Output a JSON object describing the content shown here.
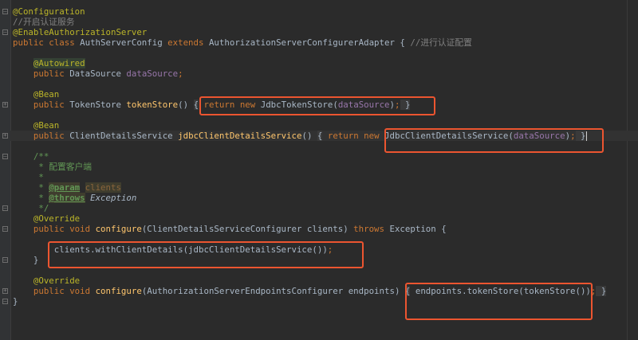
{
  "editor": {
    "current_line": 12,
    "lines": [
      [
        [
          "@Configuration",
          "ann"
        ]
      ],
      [
        [
          "//开启认证服务",
          "cm"
        ]
      ],
      [
        [
          "@EnableAuthorizationServer",
          "ann"
        ]
      ],
      [
        [
          "public class ",
          "kw"
        ],
        [
          "AuthServerConfig ",
          ""
        ],
        [
          "extends ",
          "kw"
        ],
        [
          "AuthorizationServerConfigurerAdapter { ",
          ""
        ],
        [
          "//进行认证配置",
          "cm"
        ]
      ],
      [],
      [
        [
          "    ",
          ""
        ],
        [
          "@Autowired",
          "ann ann-hl"
        ]
      ],
      [
        [
          "    public ",
          "kw"
        ],
        [
          "DataSource ",
          ""
        ],
        [
          "dataSource",
          "fld"
        ],
        [
          ";",
          "kw"
        ]
      ],
      [],
      [
        [
          "    ",
          ""
        ],
        [
          "@Bean",
          "ann"
        ]
      ],
      [
        [
          "    public ",
          "kw"
        ],
        [
          "TokenStore ",
          ""
        ],
        [
          "tokenStore",
          "fn"
        ],
        [
          "() ",
          ""
        ],
        [
          "{",
          "fold-b"
        ],
        [
          " return new ",
          "kw"
        ],
        [
          "JdbcTokenStore(",
          ""
        ],
        [
          "dataSource",
          "fld"
        ],
        [
          ")",
          ""
        ],
        [
          ";",
          "kw"
        ],
        [
          " }",
          "fold-b"
        ]
      ],
      [],
      [
        [
          "    ",
          ""
        ],
        [
          "@Bean",
          "ann"
        ]
      ],
      [
        [
          "    public ",
          "kw"
        ],
        [
          "ClientDetailsService ",
          ""
        ],
        [
          "jdbcClientDetailsService",
          "fn"
        ],
        [
          "() ",
          ""
        ],
        [
          "{",
          "fold-b"
        ],
        [
          " return new ",
          "kw"
        ],
        [
          "JdbcClientDetailsService(",
          ""
        ],
        [
          "dataSource",
          "fld"
        ],
        [
          ")",
          ""
        ],
        [
          ";",
          "kw"
        ],
        [
          " }",
          "fold-b"
        ]
      ],
      [],
      [
        [
          "    /**",
          "doc"
        ]
      ],
      [
        [
          "     * 配置客户端",
          "doc"
        ]
      ],
      [
        [
          "     *",
          "doc"
        ]
      ],
      [
        [
          "     * ",
          "doc"
        ],
        [
          "@param",
          "doctag"
        ],
        [
          " ",
          ""
        ],
        [
          "clients",
          "docparam"
        ]
      ],
      [
        [
          "     * ",
          "doc"
        ],
        [
          "@throws",
          "doctag"
        ],
        [
          " ",
          ""
        ],
        [
          "Exception",
          "docref"
        ]
      ],
      [
        [
          "     */",
          "doc"
        ]
      ],
      [
        [
          "    ",
          ""
        ],
        [
          "@Override",
          "ann"
        ]
      ],
      [
        [
          "    public void ",
          "kw"
        ],
        [
          "configure",
          "fn"
        ],
        [
          "(ClientDetailsServiceConfigurer clients) ",
          ""
        ],
        [
          "throws ",
          "kw"
        ],
        [
          "Exception {",
          ""
        ]
      ],
      [],
      [
        [
          "        clients.withClientDetails(jdbcClientDetailsService())",
          ""
        ],
        [
          ";",
          "kw"
        ]
      ],
      [
        [
          "    }",
          ""
        ]
      ],
      [],
      [
        [
          "    ",
          ""
        ],
        [
          "@Override",
          "ann"
        ]
      ],
      [
        [
          "    public void ",
          "kw"
        ],
        [
          "configure",
          "fn"
        ],
        [
          "(AuthorizationServerEndpointsConfigurer endpoints) ",
          ""
        ],
        [
          "{",
          "fold-b"
        ],
        [
          " endpoints.tokenStore(tokenStore())",
          ""
        ],
        [
          ";",
          "kw"
        ],
        [
          " }",
          "fold-b"
        ]
      ],
      [
        [
          "}",
          ""
        ]
      ]
    ]
  },
  "colors": {
    "highlight_box": "#ec5530",
    "background": "#2b2b2b"
  }
}
